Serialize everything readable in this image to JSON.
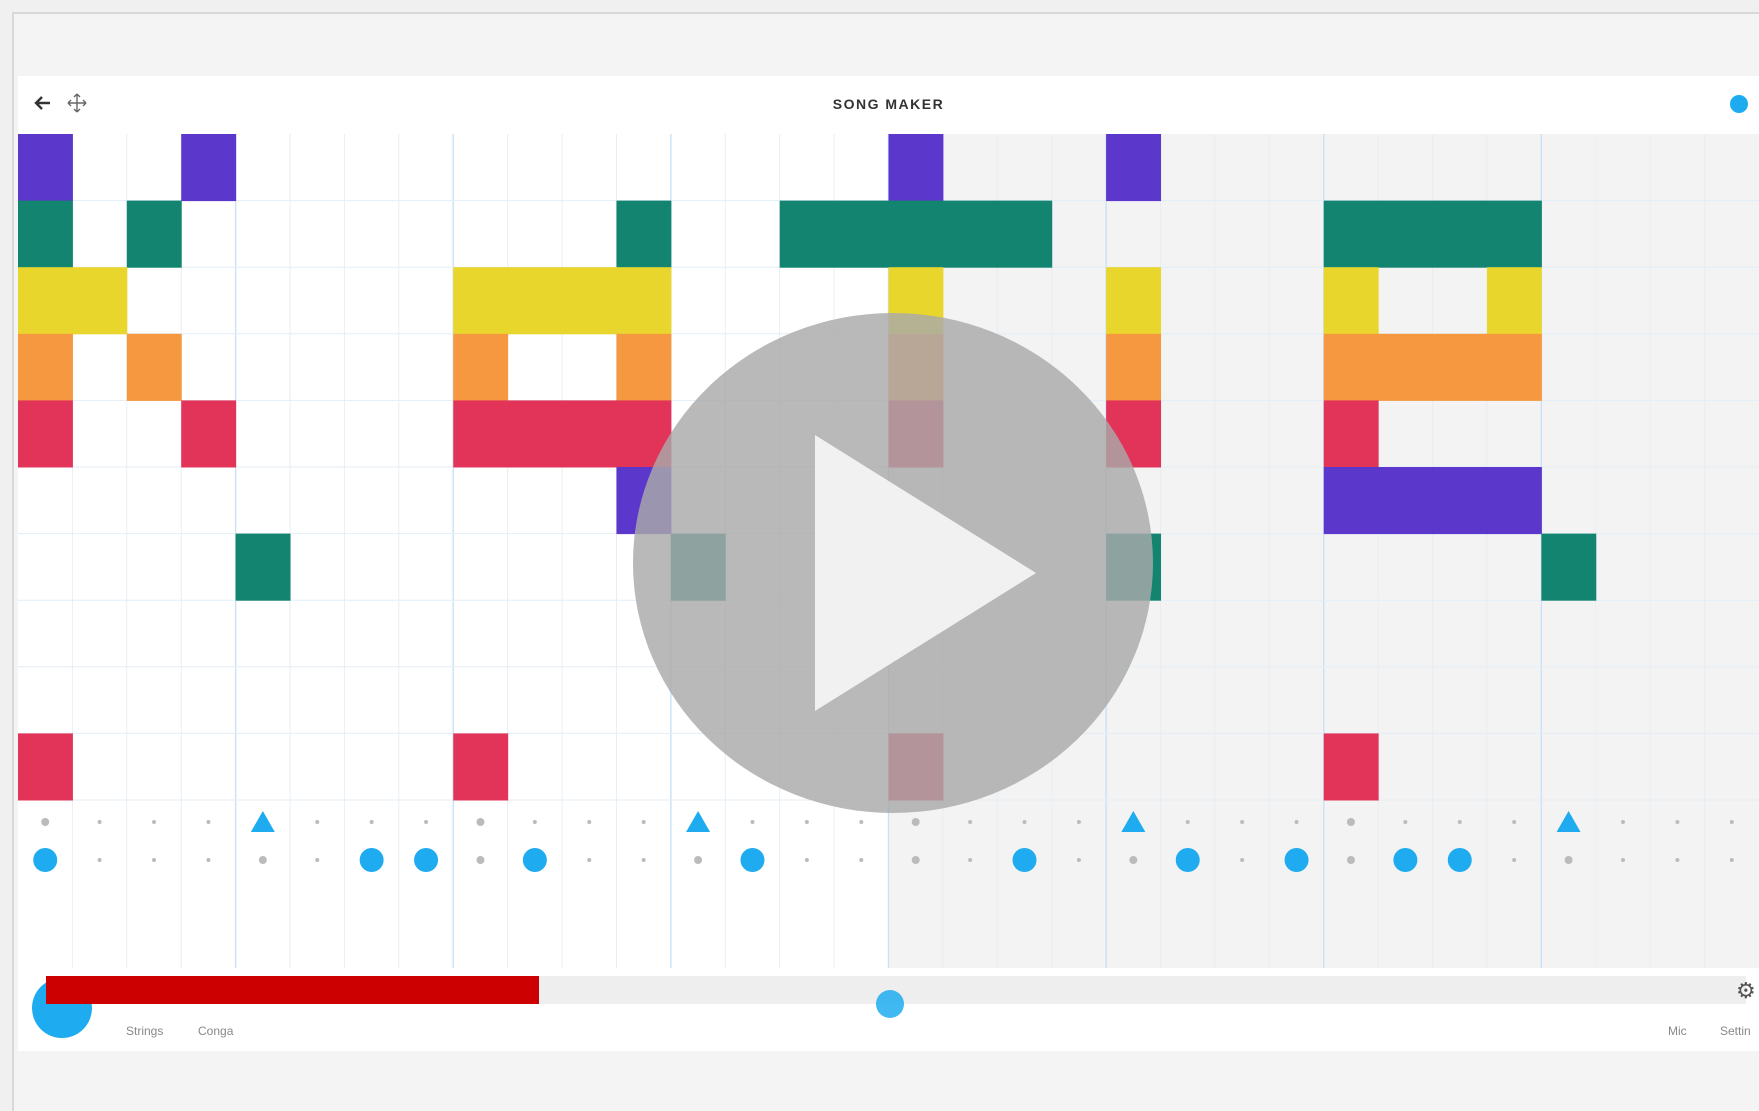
{
  "window": {
    "title": "SONG MAKER"
  },
  "toolbar": {
    "back_icon": "arrow-left-icon",
    "move_icon": "move-icon",
    "status_color": "#1eabf0"
  },
  "bottom_bar": {
    "instrument_labels": [
      "Strings",
      "Conga"
    ],
    "right_labels": [
      "Mic",
      "Settin"
    ],
    "progress": 0.29,
    "settings_icon": "gear-icon",
    "play_icon": "play-icon"
  },
  "colors": {
    "purple": "#5b37cb",
    "teal": "#138470",
    "yellow": "#e9d62d",
    "orange": "#f69840",
    "red": "#e23459",
    "blue": "#1eabf0",
    "progress_red": "#cc0000"
  },
  "melody": {
    "columns": 32,
    "rows": 10,
    "shaded_from_column": 16,
    "notes": [
      {
        "c": 0,
        "r": 0,
        "color": "purple"
      },
      {
        "c": 3,
        "r": 0,
        "color": "purple"
      },
      {
        "c": 16,
        "r": 0,
        "color": "purple"
      },
      {
        "c": 20,
        "r": 0,
        "color": "purple"
      },
      {
        "c": 0,
        "r": 1,
        "color": "teal"
      },
      {
        "c": 2,
        "r": 1,
        "color": "teal"
      },
      {
        "c": 11,
        "r": 1,
        "color": "teal"
      },
      {
        "c": 14,
        "r": 1,
        "color": "teal"
      },
      {
        "c": 15,
        "r": 1,
        "color": "teal"
      },
      {
        "c": 16,
        "r": 1,
        "color": "teal"
      },
      {
        "c": 17,
        "r": 1,
        "color": "teal"
      },
      {
        "c": 18,
        "r": 1,
        "color": "teal"
      },
      {
        "c": 24,
        "r": 1,
        "color": "teal"
      },
      {
        "c": 25,
        "r": 1,
        "color": "teal"
      },
      {
        "c": 26,
        "r": 1,
        "color": "teal"
      },
      {
        "c": 27,
        "r": 1,
        "color": "teal"
      },
      {
        "c": 0,
        "r": 2,
        "color": "yellow"
      },
      {
        "c": 1,
        "r": 2,
        "color": "yellow"
      },
      {
        "c": 8,
        "r": 2,
        "color": "yellow"
      },
      {
        "c": 9,
        "r": 2,
        "color": "yellow"
      },
      {
        "c": 10,
        "r": 2,
        "color": "yellow"
      },
      {
        "c": 11,
        "r": 2,
        "color": "yellow"
      },
      {
        "c": 16,
        "r": 2,
        "color": "yellow"
      },
      {
        "c": 20,
        "r": 2,
        "color": "yellow"
      },
      {
        "c": 24,
        "r": 2,
        "color": "yellow"
      },
      {
        "c": 27,
        "r": 2,
        "color": "yellow"
      },
      {
        "c": 0,
        "r": 3,
        "color": "orange"
      },
      {
        "c": 2,
        "r": 3,
        "color": "orange"
      },
      {
        "c": 8,
        "r": 3,
        "color": "orange"
      },
      {
        "c": 11,
        "r": 3,
        "color": "orange"
      },
      {
        "c": 16,
        "r": 3,
        "color": "orange"
      },
      {
        "c": 20,
        "r": 3,
        "color": "orange"
      },
      {
        "c": 24,
        "r": 3,
        "color": "orange"
      },
      {
        "c": 25,
        "r": 3,
        "color": "orange"
      },
      {
        "c": 26,
        "r": 3,
        "color": "orange"
      },
      {
        "c": 27,
        "r": 3,
        "color": "orange"
      },
      {
        "c": 0,
        "r": 4,
        "color": "red"
      },
      {
        "c": 3,
        "r": 4,
        "color": "red"
      },
      {
        "c": 8,
        "r": 4,
        "color": "red"
      },
      {
        "c": 9,
        "r": 4,
        "color": "red"
      },
      {
        "c": 10,
        "r": 4,
        "color": "red"
      },
      {
        "c": 11,
        "r": 4,
        "color": "red"
      },
      {
        "c": 16,
        "r": 4,
        "color": "red"
      },
      {
        "c": 20,
        "r": 4,
        "color": "red"
      },
      {
        "c": 24,
        "r": 4,
        "color": "red"
      },
      {
        "c": 11,
        "r": 5,
        "color": "purple"
      },
      {
        "c": 24,
        "r": 5,
        "color": "purple"
      },
      {
        "c": 25,
        "r": 5,
        "color": "purple"
      },
      {
        "c": 26,
        "r": 5,
        "color": "purple"
      },
      {
        "c": 27,
        "r": 5,
        "color": "purple"
      },
      {
        "c": 4,
        "r": 6,
        "color": "teal"
      },
      {
        "c": 12,
        "r": 6,
        "color": "teal"
      },
      {
        "c": 20,
        "r": 6,
        "color": "teal"
      },
      {
        "c": 28,
        "r": 6,
        "color": "teal"
      },
      {
        "c": 0,
        "r": 9,
        "color": "red"
      },
      {
        "c": 8,
        "r": 9,
        "color": "red"
      },
      {
        "c": 16,
        "r": 9,
        "color": "red"
      },
      {
        "c": 24,
        "r": 9,
        "color": "red"
      }
    ]
  },
  "rhythm": {
    "triangles": [
      4,
      12,
      20,
      28
    ],
    "circles": [
      0,
      6,
      7,
      9,
      13,
      18,
      21,
      23,
      25,
      26
    ]
  }
}
